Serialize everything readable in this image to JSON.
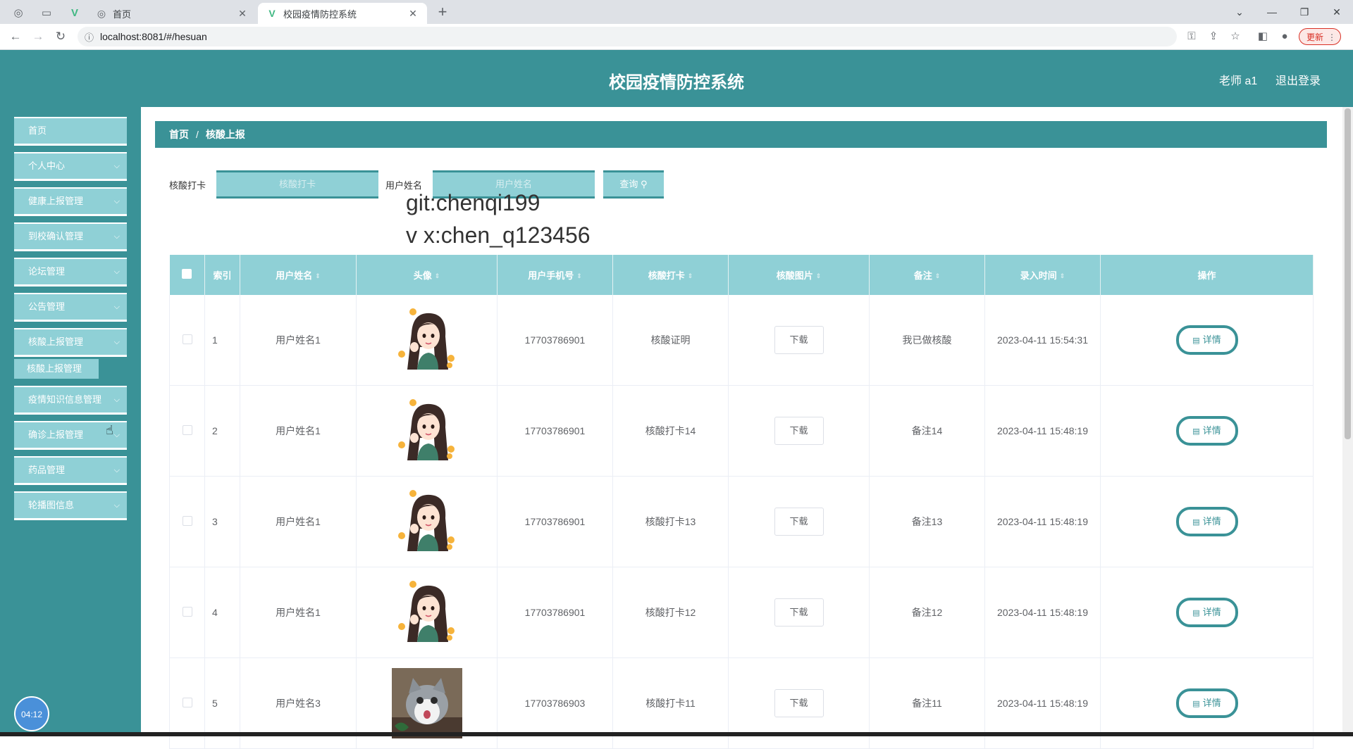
{
  "browser": {
    "tabs": [
      {
        "label": "首页",
        "active": false
      },
      {
        "label": "校园疫情防控系统",
        "active": true
      }
    ],
    "url": "localhost:8081/#/hesuan",
    "update_label": "更新"
  },
  "header": {
    "title": "校园疫情防控系统",
    "user": "老师 a1",
    "logout": "退出登录"
  },
  "sidebar": {
    "items": [
      {
        "label": "首页",
        "has_children": false
      },
      {
        "label": "个人中心",
        "has_children": true
      },
      {
        "label": "健康上报管理",
        "has_children": true
      },
      {
        "label": "到校确认管理",
        "has_children": true
      },
      {
        "label": "论坛管理",
        "has_children": true
      },
      {
        "label": "公告管理",
        "has_children": true
      },
      {
        "label": "核酸上报管理",
        "has_children": true
      },
      {
        "label": "疫情知识信息管理",
        "has_children": true
      },
      {
        "label": "确诊上报管理",
        "has_children": true
      },
      {
        "label": "药品管理",
        "has_children": true
      },
      {
        "label": "轮播图信息",
        "has_children": true
      }
    ],
    "submenu": {
      "label": "核酸上报管理"
    },
    "clock": "04:12"
  },
  "breadcrumb": {
    "home": "首页",
    "current": "核酸上报",
    "separator": "/"
  },
  "search": {
    "field1_label": "核酸打卡",
    "field1_placeholder": "核酸打卡",
    "field2_label": "用户姓名",
    "field2_placeholder": "用户姓名",
    "button_label": "查询"
  },
  "watermark": {
    "line1": "git:chenqi199",
    "line2": "v x:chen_q123456"
  },
  "table": {
    "columns": [
      "索引",
      "用户姓名",
      "头像",
      "用户手机号",
      "核酸打卡",
      "核酸图片",
      "备注",
      "录入时间",
      "操作"
    ],
    "download_label": "下载",
    "detail_label": "详情",
    "rows": [
      {
        "index": "1",
        "name": "用户姓名1",
        "phone": "17703786901",
        "checkin": "核酸证明",
        "note": "我已做核酸",
        "time": "2023-04-11 15:54:31",
        "avatar": "girl"
      },
      {
        "index": "2",
        "name": "用户姓名1",
        "phone": "17703786901",
        "checkin": "核酸打卡14",
        "note": "备注14",
        "time": "2023-04-11 15:48:19",
        "avatar": "girl"
      },
      {
        "index": "3",
        "name": "用户姓名1",
        "phone": "17703786901",
        "checkin": "核酸打卡13",
        "note": "备注13",
        "time": "2023-04-11 15:48:19",
        "avatar": "girl"
      },
      {
        "index": "4",
        "name": "用户姓名1",
        "phone": "17703786901",
        "checkin": "核酸打卡12",
        "note": "备注12",
        "time": "2023-04-11 15:48:19",
        "avatar": "girl"
      },
      {
        "index": "5",
        "name": "用户姓名3",
        "phone": "17703786903",
        "checkin": "核酸打卡11",
        "note": "备注11",
        "time": "2023-04-11 15:48:19",
        "avatar": "cat"
      }
    ]
  },
  "colors": {
    "primary": "#3a9297",
    "light": "#8fd0d6"
  }
}
